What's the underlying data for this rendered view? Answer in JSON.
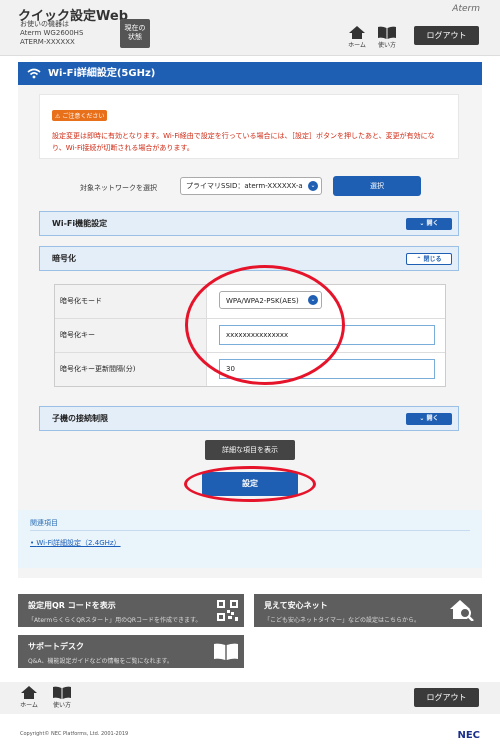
{
  "header": {
    "app_title": "クイック設定Web",
    "device_label": "お使いの機器は",
    "device_model": "Aterm WG2600HS",
    "device_id": "ATERM-XXXXXX",
    "status_button": "現在の\n状態",
    "brand": "Aterm",
    "home_label": "ホーム",
    "help_label": "使い方",
    "logout": "ログアウト"
  },
  "page_title": "Wi-Fi詳細設定(5GHz)",
  "caution": {
    "badge": "ご注意ください",
    "text": "設定変更は即時に有効となります。Wi-Fi経由で設定を行っている場合には、［設定］ボタンを押したあと、変更が有効になり、Wi-Fi接続が切断される場合があります。"
  },
  "network_select": {
    "label": "対象ネットワークを選択",
    "value": "プライマリSSID：aterm-XXXXXX-a",
    "button": "選択"
  },
  "sections": {
    "wifi_func": {
      "title": "Wi-Fi機能設定",
      "toggle": "開く"
    },
    "encryption": {
      "title": "暗号化",
      "toggle": "閉じる"
    },
    "client_limit": {
      "title": "子機の接続制限",
      "toggle": "開く"
    }
  },
  "encryption": {
    "mode_label": "暗号化モード",
    "mode_value": "WPA/WPA2-PSK(AES)",
    "key_label": "暗号化キー",
    "key_value": "xxxxxxxxxxxxxxx",
    "interval_label": "暗号化キー更新間隔(分)",
    "interval_value": "30"
  },
  "buttons": {
    "detail": "詳細な項目を表示",
    "setting": "設定"
  },
  "related": {
    "title": "関連項目",
    "link": "Wi-Fi詳細設定（2.4GHz）"
  },
  "tiles": {
    "qr": {
      "title": "設定用QR コードを表示",
      "sub": "「AtermらくらくQRスタート」用のQRコードを作成できます。"
    },
    "safe": {
      "title": "見えて安心ネット",
      "sub": "「こども安心ネットタイマー」などの設定はこちらから。"
    },
    "support": {
      "title": "サポートデスク",
      "sub": "Q&A、機能設定ガイドなどの情報をご覧になれます。"
    }
  },
  "footer": {
    "home_label": "ホーム",
    "help_label": "使い方",
    "logout": "ログアウト",
    "copyright": "Copyright© NEC Platforms, Ltd. 2001-2019",
    "nec": "NEC"
  },
  "colors": {
    "accent": "#1f5fb3",
    "caution": "#cf2a14",
    "annotation": "#e6142b"
  }
}
